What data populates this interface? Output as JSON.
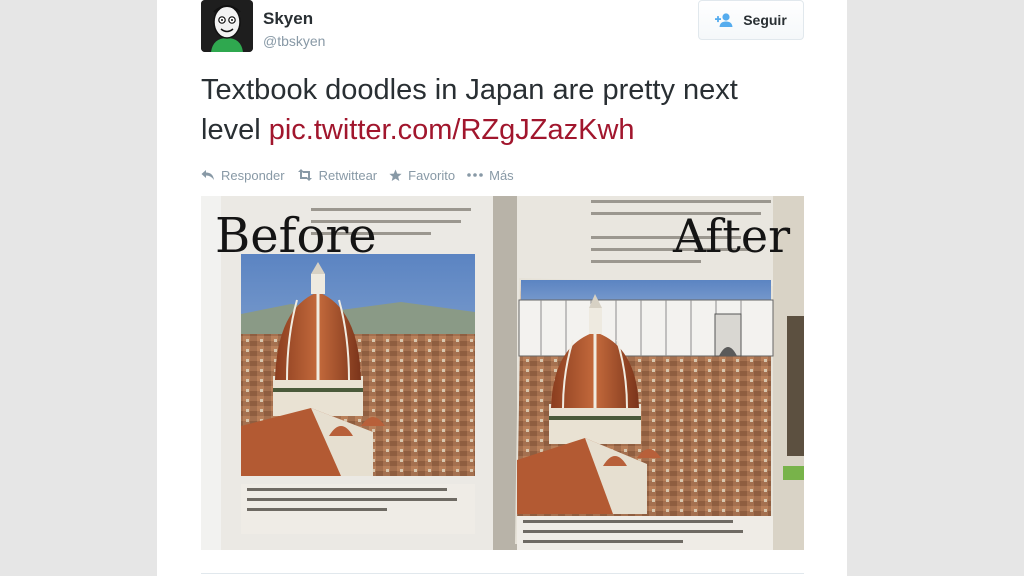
{
  "user": {
    "name": "Skyen",
    "handle": "@tbskyen",
    "avatar_icon": "cartoon-avatar"
  },
  "follow_button": {
    "label": "Seguir",
    "icon": "add-user-icon",
    "accent": "#55acee"
  },
  "tweet": {
    "text": "Textbook doodles in Japan are pretty next level",
    "link": "pic.twitter.com/RZgJZazKwh",
    "link_color": "#a1162d"
  },
  "actions": [
    {
      "label": "Responder",
      "icon": "reply-icon"
    },
    {
      "label": "Retwittear",
      "icon": "retweet-icon"
    },
    {
      "label": "Favorito",
      "icon": "star-icon"
    },
    {
      "label": "Más",
      "icon": "more-icon"
    }
  ],
  "media": {
    "left_label": "Before",
    "right_label": "After"
  }
}
